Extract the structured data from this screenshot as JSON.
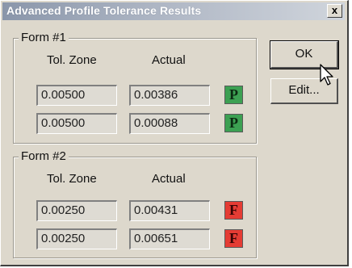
{
  "window": {
    "title": "Advanced Profile Tolerance Results",
    "close_label": "x"
  },
  "buttons": {
    "ok_label": "OK",
    "edit_label": "Edit..."
  },
  "columns": {
    "tol_zone": "Tol. Zone",
    "actual": "Actual"
  },
  "forms": [
    {
      "label": "Form #1",
      "rows": [
        {
          "tol_zone": "0.00500",
          "actual": "0.00386",
          "result": "P",
          "status": "pass"
        },
        {
          "tol_zone": "0.00500",
          "actual": "0.00088",
          "result": "P",
          "status": "pass"
        }
      ]
    },
    {
      "label": "Form #2",
      "rows": [
        {
          "tol_zone": "0.00250",
          "actual": "0.00431",
          "result": "F",
          "status": "fail"
        },
        {
          "tol_zone": "0.00250",
          "actual": "0.00651",
          "result": "F",
          "status": "fail"
        }
      ]
    }
  ],
  "colors": {
    "pass": "#3ca052",
    "fail": "#e53c34",
    "title_bar": "#8a96aa"
  },
  "icons": {
    "cursor": "mouse-pointer-icon",
    "close": "close-icon"
  }
}
